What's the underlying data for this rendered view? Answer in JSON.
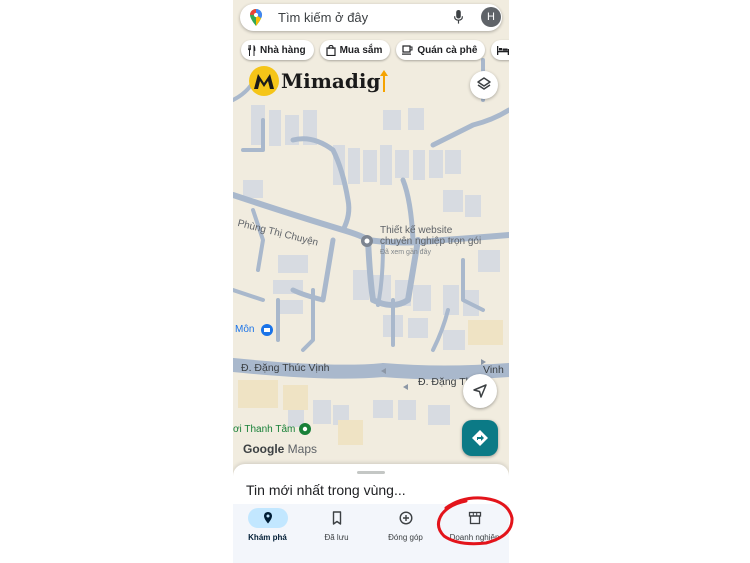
{
  "search": {
    "placeholder": "Tìm kiếm ở đây",
    "avatar_initial": "H"
  },
  "chips": [
    {
      "label": "Nhà hàng",
      "icon": "fork-knife-icon"
    },
    {
      "label": "Mua sắm",
      "icon": "shopping-bag-icon"
    },
    {
      "label": "Quán cà phê",
      "icon": "coffee-cup-icon"
    },
    {
      "label": "",
      "icon": "hotel-bed-icon"
    }
  ],
  "logo": {
    "text": "Mimadig",
    "mark": "M"
  },
  "map": {
    "streets": [
      "Phùng Thị Chuyện",
      "Đ. Đặng Thúc Vịnh",
      "Đ. Đặng Th",
      "Vinh"
    ],
    "poi": {
      "name_line1": "Thiết kế website",
      "name_line2": "chuyên nghiệp trọn gói",
      "status": "Đã xem gần đây"
    },
    "places": [
      "Môn",
      "ơi Thanh Tâm"
    ],
    "attribution_google": "Google",
    "attribution_maps": " Maps"
  },
  "sheet": {
    "title": "Tin mới nhất trong vùng..."
  },
  "nav": [
    {
      "label": "Khám phá",
      "icon": "map-pin-icon",
      "active": true
    },
    {
      "label": "Đã lưu",
      "icon": "bookmark-icon",
      "active": false
    },
    {
      "label": "Đóng góp",
      "icon": "plus-circle-icon",
      "active": false
    },
    {
      "label": "Doanh nghiệp",
      "icon": "storefront-icon",
      "active": false
    }
  ],
  "colors": {
    "accent_teal": "#0b7a86",
    "nav_active": "#c2e7ff",
    "annotation_ring": "#e3141b",
    "map_bg": "#f1ecdf",
    "road": "#a9b8cc"
  }
}
